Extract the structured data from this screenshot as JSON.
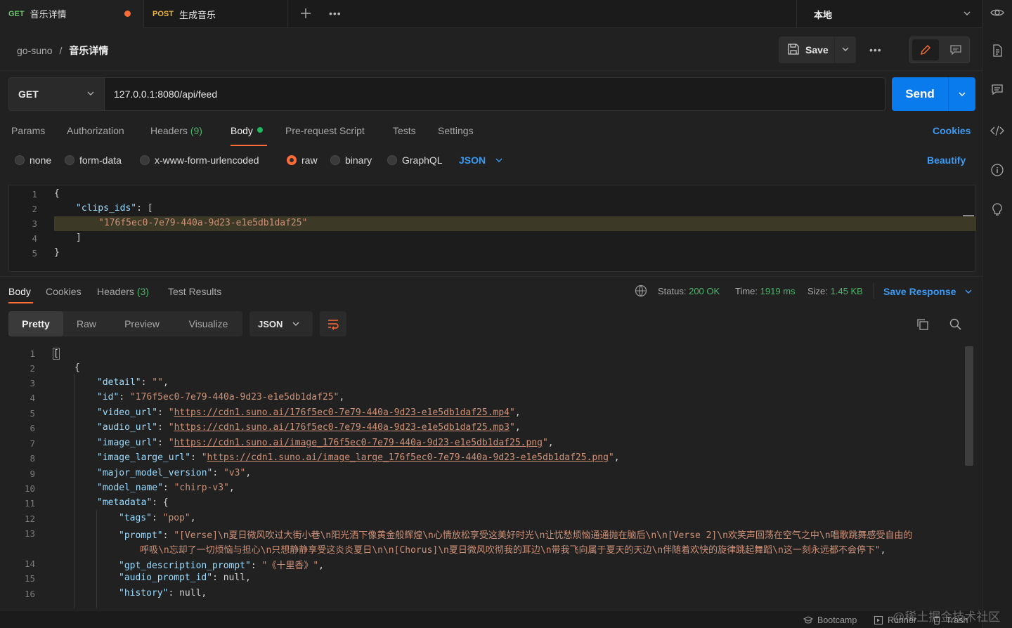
{
  "tabs": [
    {
      "method": "GET",
      "name": "音乐详情"
    },
    {
      "method": "POST",
      "name": "生成音乐"
    }
  ],
  "environment": "本地",
  "breadcrumb": {
    "collection": "go-suno",
    "separator": "/",
    "request": "音乐详情"
  },
  "toolbar": {
    "save_label": "Save",
    "more_label": "•••"
  },
  "request": {
    "method": "GET",
    "url": "127.0.0.1:8080/api/feed",
    "send_label": "Send"
  },
  "request_tabs": [
    {
      "label": "Params"
    },
    {
      "label": "Authorization"
    },
    {
      "label": "Headers",
      "count": "(9)"
    },
    {
      "label": "Body"
    },
    {
      "label": "Pre-request Script"
    },
    {
      "label": "Tests"
    },
    {
      "label": "Settings"
    }
  ],
  "cookies_label": "Cookies",
  "body_types": [
    "none",
    "form-data",
    "x-www-form-urlencoded",
    "raw",
    "binary",
    "GraphQL"
  ],
  "body_format": "JSON",
  "beautify_label": "Beautify",
  "request_body": {
    "line_numbers": [
      "1",
      "2",
      "3",
      "4",
      "5"
    ],
    "open_brace": "{",
    "key": "\"clips_ids\"",
    "colon_bracket": ": [",
    "value": "\"176f5ec0-7e79-440a-9d23-e1e5db1daf25\"",
    "close_bracket": "]",
    "close_brace": "}"
  },
  "response_tabs": [
    {
      "label": "Body"
    },
    {
      "label": "Cookies"
    },
    {
      "label": "Headers",
      "count": "(3)"
    },
    {
      "label": "Test Results"
    }
  ],
  "status": {
    "label": "Status:",
    "value": "200 OK",
    "time_label": "Time:",
    "time": "1919 ms",
    "size_label": "Size:",
    "size": "1.45 KB"
  },
  "save_response_label": "Save Response",
  "view_modes": [
    "Pretty",
    "Raw",
    "Preview",
    "Visualize"
  ],
  "response_format": "JSON",
  "response_lines": {
    "n": [
      "1",
      "2",
      "3",
      "4",
      "5",
      "6",
      "7",
      "8",
      "9",
      "10",
      "11",
      "12",
      "13",
      "14",
      "15",
      "16"
    ],
    "l1": "[",
    "l2": "{",
    "l3k": "\"detail\"",
    "l3v": "\"\"",
    "l4k": "\"id\"",
    "l4v": "\"176f5ec0-7e79-440a-9d23-e1e5db1daf25\"",
    "l5k": "\"video_url\"",
    "l5v": "https://cdn1.suno.ai/176f5ec0-7e79-440a-9d23-e1e5db1daf25.mp4",
    "l6k": "\"audio_url\"",
    "l6v": "https://cdn1.suno.ai/176f5ec0-7e79-440a-9d23-e1e5db1daf25.mp3",
    "l7k": "\"image_url\"",
    "l7v": "https://cdn1.suno.ai/image_176f5ec0-7e79-440a-9d23-e1e5db1daf25.png",
    "l8k": "\"image_large_url\"",
    "l8v": "https://cdn1.suno.ai/image_large_176f5ec0-7e79-440a-9d23-e1e5db1daf25.png",
    "l9k": "\"major_model_version\"",
    "l9v": "\"v3\"",
    "l10k": "\"model_name\"",
    "l10v": "\"chirp-v3\"",
    "l11k": "\"metadata\"",
    "l11v": ": {",
    "l12k": "\"tags\"",
    "l12v": "\"pop\"",
    "l13k": "\"prompt\"",
    "l13v": "\"[Verse]\\n夏日微风吹过大街小巷\\n阳光洒下像黄金般辉煌\\n心情放松享受这美好时光\\n让忧愁烦恼通通抛在脑后\\n\\n[Verse 2]\\n欢笑声回荡在空气之中\\n唱歌跳舞感受自由的",
    "l13v2": "呼吸\\n忘却了一切烦恼与担心\\n只想静静享受这炎炎夏日\\n\\n[Chorus]\\n夏日微风吹彻我的耳边\\n带我飞向属于夏天的天边\\n伴随着欢快的旋律跳起舞蹈\\n这一刻永远都不会停下\"",
    "l14k": "\"gpt_description_prompt\"",
    "l14v": "\"《十里香》\"",
    "l15k": "\"audio_prompt_id\"",
    "l15v": "null",
    "l16k": "\"history\"",
    "l16v": "null"
  },
  "footer": {
    "bootcamp": "Bootcamp",
    "runner": "Runner",
    "trash": "Trash"
  },
  "watermark": "@稀土掘金技术社区"
}
